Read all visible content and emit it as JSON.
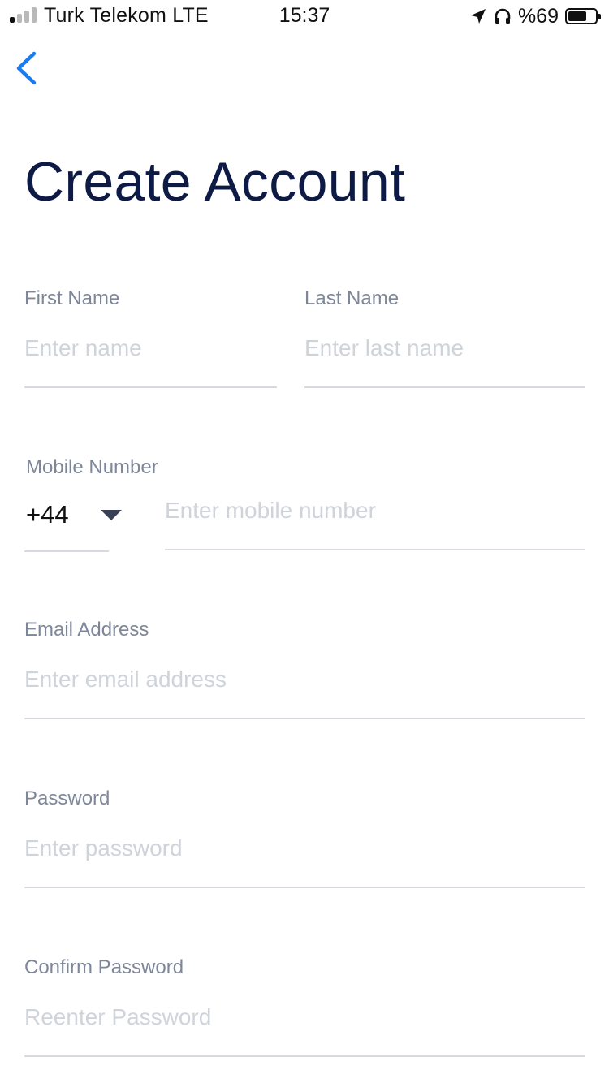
{
  "status_bar": {
    "carrier": "Turk Telekom LTE",
    "time": "15:37",
    "battery_percent": "%69",
    "icons": [
      "signal-icon",
      "location-arrow-icon",
      "headphones-icon",
      "battery-icon"
    ]
  },
  "nav": {
    "back_icon": "chevron-left-icon"
  },
  "page": {
    "title": "Create Account"
  },
  "form": {
    "first_name": {
      "label": "First Name",
      "placeholder": "Enter name",
      "value": ""
    },
    "last_name": {
      "label": "Last Name",
      "placeholder": "Enter last name",
      "value": ""
    },
    "mobile": {
      "label": "Mobile Number",
      "country_code": "+44",
      "placeholder": "Enter mobile number",
      "value": ""
    },
    "email": {
      "label": "Email Address",
      "placeholder": "Enter email address",
      "value": ""
    },
    "password": {
      "label": "Password",
      "placeholder": "Enter password",
      "value": ""
    },
    "confirm_password": {
      "label": "Confirm Password",
      "placeholder": "Reenter Password",
      "value": ""
    }
  },
  "colors": {
    "accent": "#1a7cf0",
    "title": "#0d1a45",
    "label": "#7e8799",
    "placeholder": "#cfd3da",
    "underline": "#d7dae0"
  }
}
